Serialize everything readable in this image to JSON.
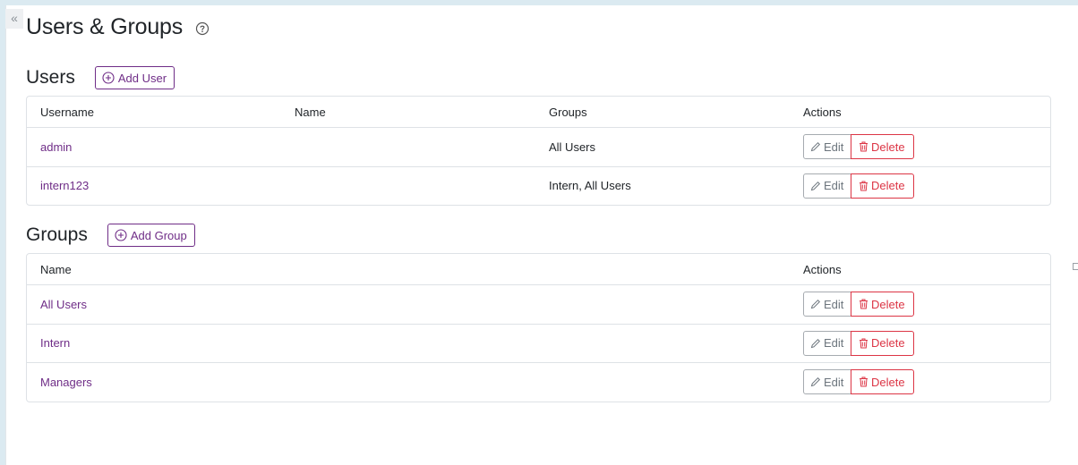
{
  "sidebar": {
    "collapse_glyph": "«",
    "collapse_icon": "chevron-double-left-icon"
  },
  "page": {
    "title": "Users & Groups",
    "help_icon": "question-circle-icon"
  },
  "colors": {
    "accent": "#6f2d87",
    "danger": "#dc3545",
    "muted": "#6c757d",
    "border": "#dee2e6"
  },
  "users": {
    "title": "Users",
    "add_label": "Add User",
    "columns": [
      "Username",
      "Name",
      "Groups",
      "Actions"
    ],
    "rows": [
      {
        "username": "admin",
        "name": "",
        "groups": "All Users"
      },
      {
        "username": "intern123",
        "name": "",
        "groups": "Intern, All Users"
      }
    ]
  },
  "groups": {
    "title": "Groups",
    "add_label": "Add Group",
    "columns": [
      "Name",
      "Actions"
    ],
    "rows": [
      {
        "name": "All Users"
      },
      {
        "name": "Intern"
      },
      {
        "name": "Managers"
      }
    ]
  },
  "actions": {
    "edit_label": "Edit",
    "delete_label": "Delete",
    "edit_icon": "pencil-icon",
    "delete_icon": "trash-icon"
  }
}
